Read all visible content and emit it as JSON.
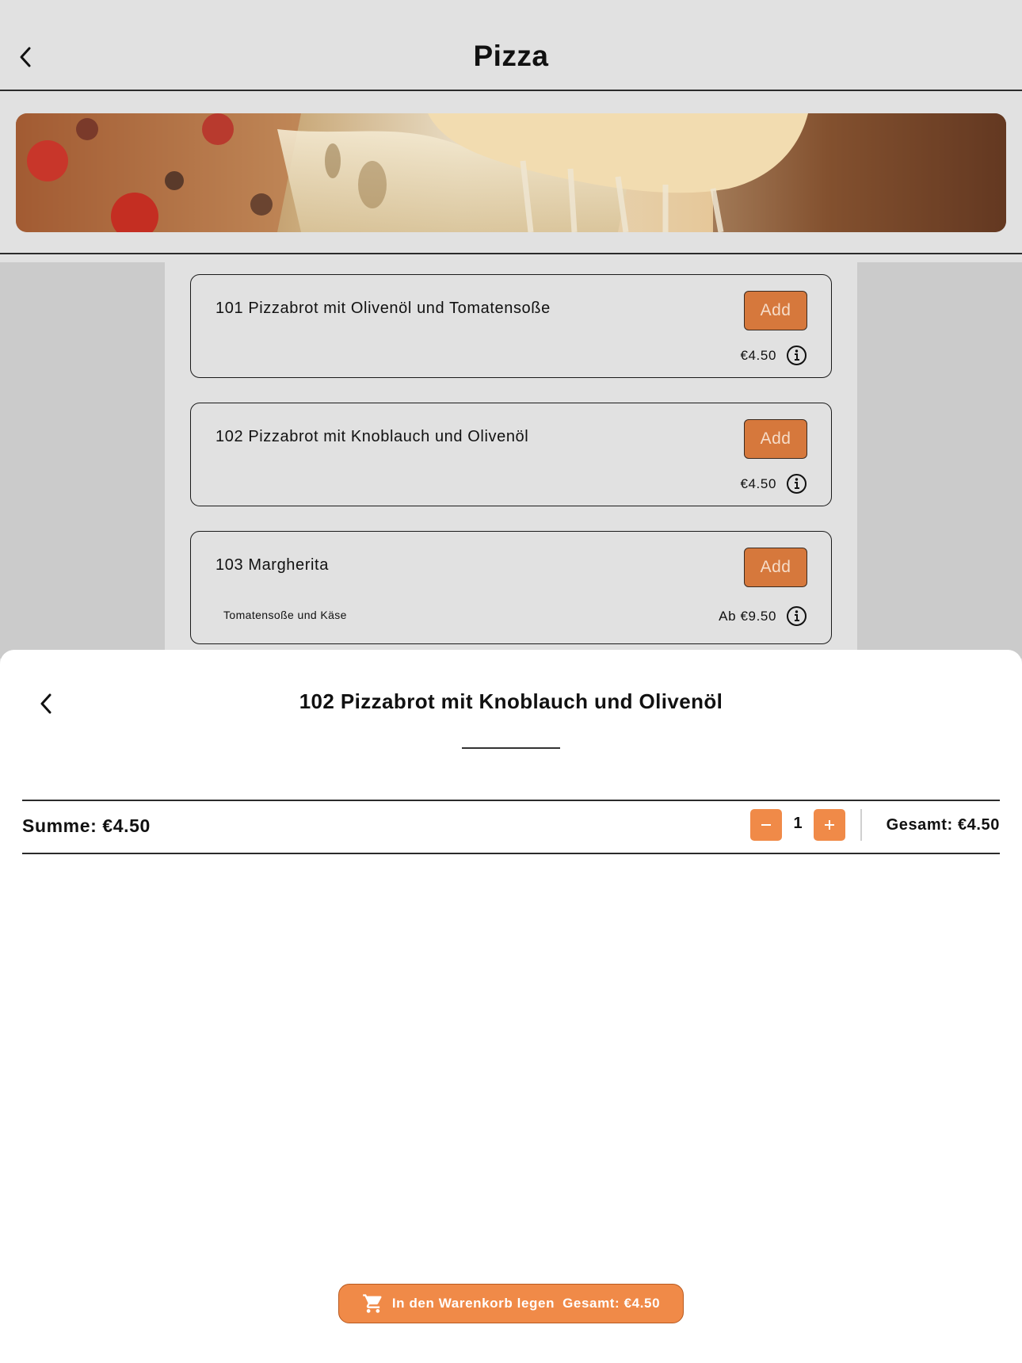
{
  "header": {
    "title": "Pizza"
  },
  "banner": {
    "description_icon": "pizza-banner-image"
  },
  "items": [
    {
      "name": "101 Pizzabrot mit Olivenöl und Tomatensoße",
      "description": "",
      "price": "€4.50",
      "add_label": "Add"
    },
    {
      "name": "102 Pizzabrot mit Knoblauch und Olivenöl",
      "description": "",
      "price": "€4.50",
      "add_label": "Add"
    },
    {
      "name": "103 Margherita",
      "description": "Tomatensoße und Käse",
      "price": "Ab €9.50",
      "add_label": "Add"
    }
  ],
  "sheet": {
    "title": "102 Pizzabrot mit Knoblauch und Olivenöl",
    "summe": "Summe: €4.50",
    "quantity": "1",
    "gesamt": "Gesamt: €4.50",
    "cart_button_label": "In den Warenkorb legen",
    "cart_button_total": "Gesamt: €4.50"
  },
  "colors": {
    "accent": "#f08a48",
    "add_button": "#d6783c",
    "background": "#e1e1e1",
    "side_panel": "#cbcbcb"
  }
}
